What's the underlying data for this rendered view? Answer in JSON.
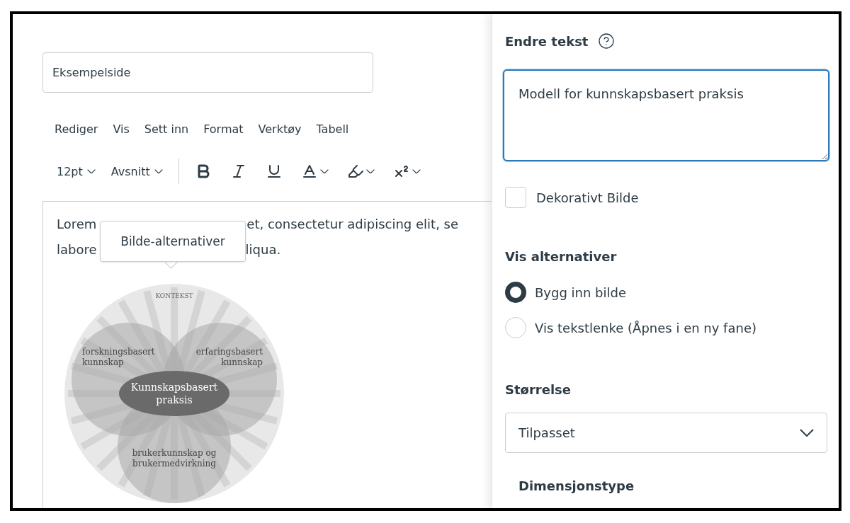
{
  "editor": {
    "title_field": {
      "value": "Eksempelside"
    },
    "menu": [
      "Rediger",
      "Vis",
      "Sett inn",
      "Format",
      "Verktøy",
      "Tabell"
    ],
    "toolbar": {
      "font_size": "12pt",
      "block_format": "Avsnitt",
      "tools": [
        {
          "kind": "bold"
        },
        {
          "kind": "italic"
        },
        {
          "kind": "underline"
        },
        {
          "kind": "text-color",
          "dropdown": true
        },
        {
          "kind": "highlight",
          "dropdown": true
        },
        {
          "kind": "superscript",
          "dropdown": true
        }
      ]
    },
    "content": {
      "lines": [
        {
          "start": "Lorem",
          "end": "et, consectetur adipiscing elit, se"
        },
        {
          "start": "labore",
          "end": "liqua."
        }
      ],
      "tooltip": "Bilde-alternativer",
      "image": {
        "outer_label": "KONTEKST",
        "left_label": [
          "forskningsbasert",
          "kunnskap"
        ],
        "right_label": [
          "erfaringsbasert",
          "kunnskap"
        ],
        "center_label": [
          "Kunnskapsbasert",
          "praksis"
        ],
        "bottom_label": [
          "brukerkunnskap og",
          "brukermedvirkning"
        ]
      }
    }
  },
  "panel": {
    "alt_text": {
      "label": "Endre tekst",
      "value": "Modell for kunnskapsbasert praksis"
    },
    "decorative": {
      "label": "Dekorativt Bilde",
      "checked": false
    },
    "display": {
      "heading": "Vis alternativer",
      "options": [
        {
          "label": "Bygg inn bilde",
          "selected": true
        },
        {
          "label": "Vis tekstlenke (Åpnes i en ny fane)",
          "selected": false
        }
      ]
    },
    "size": {
      "heading": "Størrelse",
      "value": "Tilpasset"
    },
    "dimension_type": {
      "heading": "Dimensjonstype"
    }
  }
}
